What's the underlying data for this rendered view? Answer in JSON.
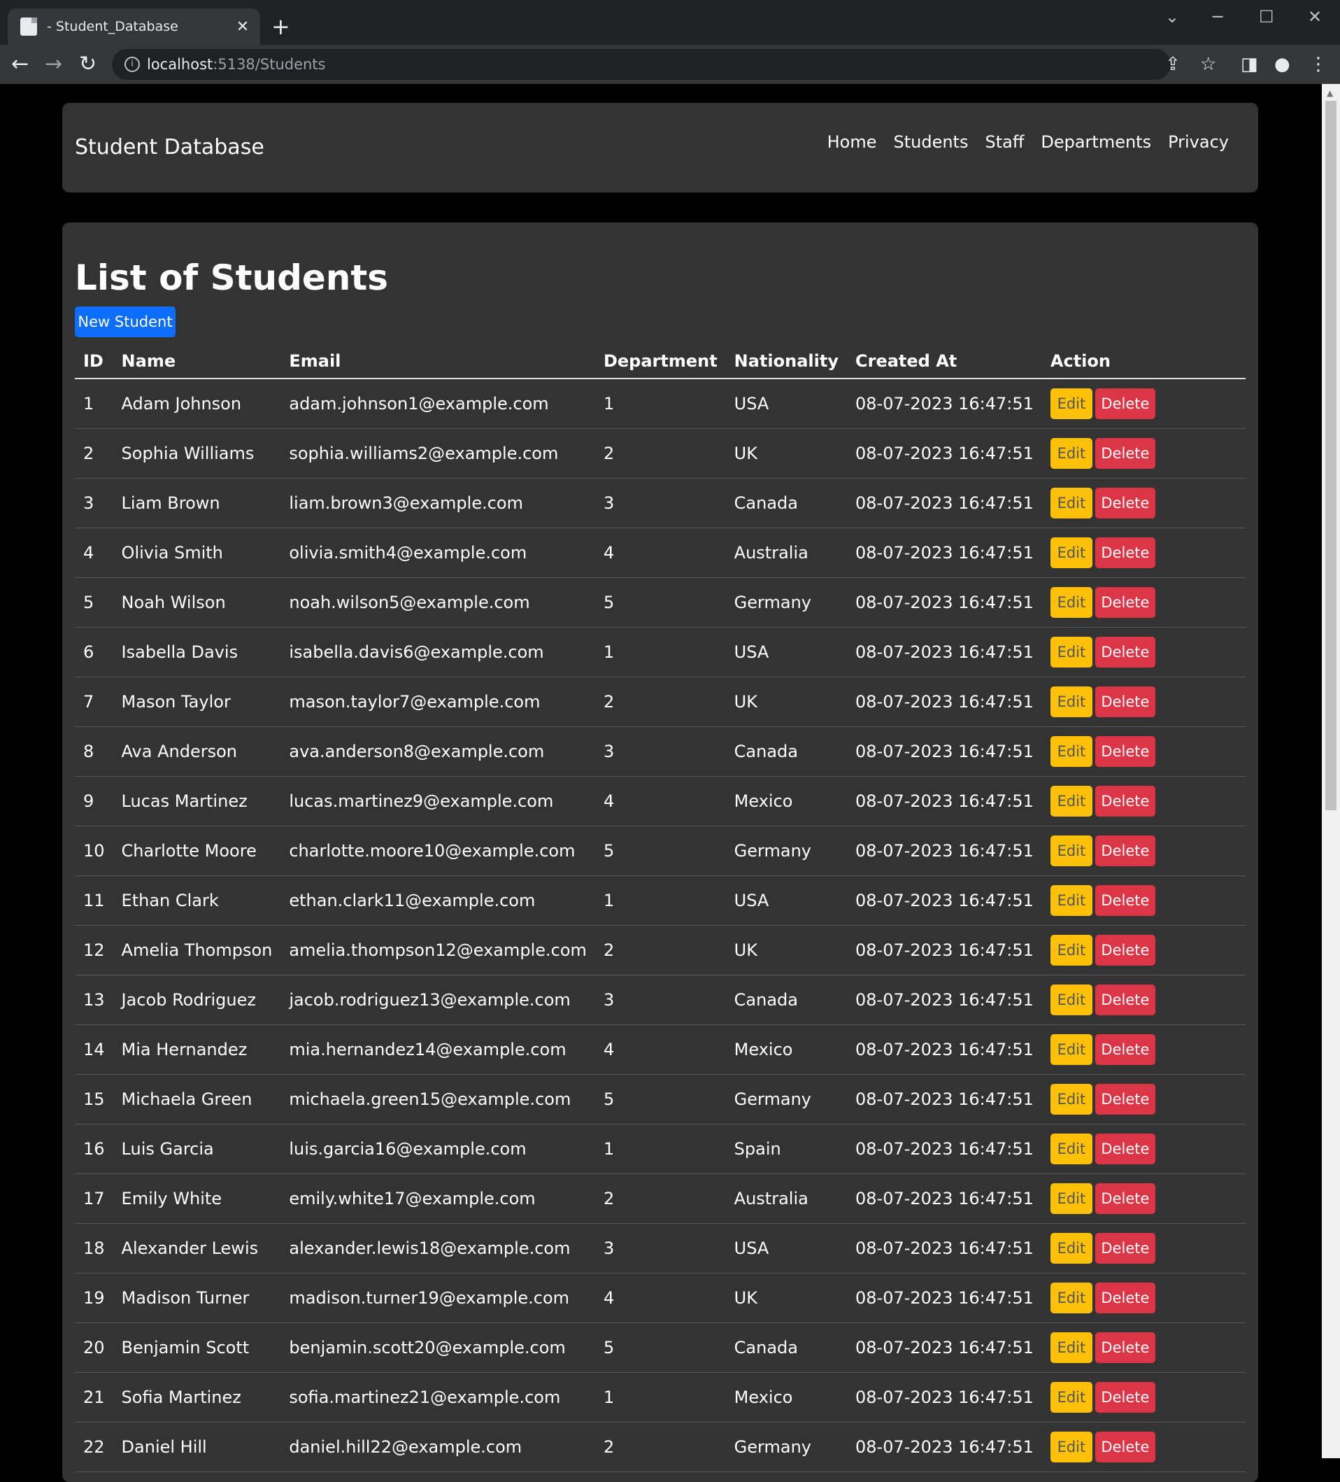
{
  "browser": {
    "tab_title": "- Student_Database",
    "url_host": "localhost",
    "url_rest": ":5138/Students"
  },
  "navbar": {
    "brand": "Student Database",
    "links": [
      "Home",
      "Students",
      "Staff",
      "Departments",
      "Privacy"
    ]
  },
  "main": {
    "title": "List of Students",
    "new_button": "New Student",
    "columns": [
      "ID",
      "Name",
      "Email",
      "Department",
      "Nationality",
      "Created At",
      "Action"
    ],
    "edit_label": "Edit",
    "delete_label": "Delete",
    "rows": [
      [
        "1",
        "Adam Johnson",
        "adam.johnson1@example.com",
        "1",
        "USA",
        "08-07-2023 16:47:51"
      ],
      [
        "2",
        "Sophia Williams",
        "sophia.williams2@example.com",
        "2",
        "UK",
        "08-07-2023 16:47:51"
      ],
      [
        "3",
        "Liam Brown",
        "liam.brown3@example.com",
        "3",
        "Canada",
        "08-07-2023 16:47:51"
      ],
      [
        "4",
        "Olivia Smith",
        "olivia.smith4@example.com",
        "4",
        "Australia",
        "08-07-2023 16:47:51"
      ],
      [
        "5",
        "Noah Wilson",
        "noah.wilson5@example.com",
        "5",
        "Germany",
        "08-07-2023 16:47:51"
      ],
      [
        "6",
        "Isabella Davis",
        "isabella.davis6@example.com",
        "1",
        "USA",
        "08-07-2023 16:47:51"
      ],
      [
        "7",
        "Mason Taylor",
        "mason.taylor7@example.com",
        "2",
        "UK",
        "08-07-2023 16:47:51"
      ],
      [
        "8",
        "Ava Anderson",
        "ava.anderson8@example.com",
        "3",
        "Canada",
        "08-07-2023 16:47:51"
      ],
      [
        "9",
        "Lucas Martinez",
        "lucas.martinez9@example.com",
        "4",
        "Mexico",
        "08-07-2023 16:47:51"
      ],
      [
        "10",
        "Charlotte Moore",
        "charlotte.moore10@example.com",
        "5",
        "Germany",
        "08-07-2023 16:47:51"
      ],
      [
        "11",
        "Ethan Clark",
        "ethan.clark11@example.com",
        "1",
        "USA",
        "08-07-2023 16:47:51"
      ],
      [
        "12",
        "Amelia Thompson",
        "amelia.thompson12@example.com",
        "2",
        "UK",
        "08-07-2023 16:47:51"
      ],
      [
        "13",
        "Jacob Rodriguez",
        "jacob.rodriguez13@example.com",
        "3",
        "Canada",
        "08-07-2023 16:47:51"
      ],
      [
        "14",
        "Mia Hernandez",
        "mia.hernandez14@example.com",
        "4",
        "Mexico",
        "08-07-2023 16:47:51"
      ],
      [
        "15",
        "Michaela Green",
        "michaela.green15@example.com",
        "5",
        "Germany",
        "08-07-2023 16:47:51"
      ],
      [
        "16",
        "Luis Garcia",
        "luis.garcia16@example.com",
        "1",
        "Spain",
        "08-07-2023 16:47:51"
      ],
      [
        "17",
        "Emily White",
        "emily.white17@example.com",
        "2",
        "Australia",
        "08-07-2023 16:47:51"
      ],
      [
        "18",
        "Alexander Lewis",
        "alexander.lewis18@example.com",
        "3",
        "USA",
        "08-07-2023 16:47:51"
      ],
      [
        "19",
        "Madison Turner",
        "madison.turner19@example.com",
        "4",
        "UK",
        "08-07-2023 16:47:51"
      ],
      [
        "20",
        "Benjamin Scott",
        "benjamin.scott20@example.com",
        "5",
        "Canada",
        "08-07-2023 16:47:51"
      ],
      [
        "21",
        "Sofia Martinez",
        "sofia.martinez21@example.com",
        "1",
        "Mexico",
        "08-07-2023 16:47:51"
      ],
      [
        "22",
        "Daniel Hill",
        "daniel.hill22@example.com",
        "2",
        "Germany",
        "08-07-2023 16:47:51"
      ]
    ]
  }
}
